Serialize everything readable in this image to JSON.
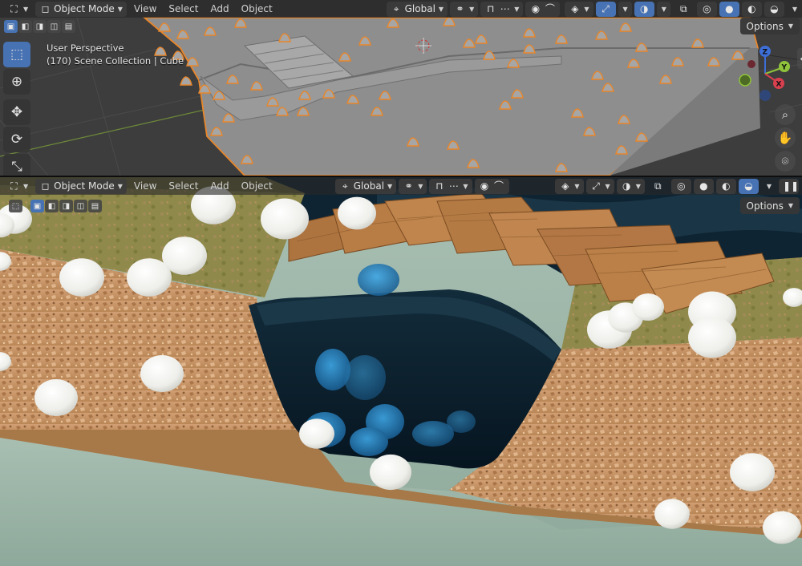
{
  "top_header": {
    "mode_label": "Object Mode",
    "menus": [
      "View",
      "Select",
      "Add",
      "Object"
    ],
    "transform_orientation": "Global",
    "options_label": "Options"
  },
  "bottom_header": {
    "mode_label": "Object Mode",
    "menus": [
      "View",
      "Select",
      "Add",
      "Object"
    ],
    "transform_orientation": "Global",
    "options_label": "Options"
  },
  "top_viewport": {
    "perspective_label": "User Perspective",
    "collection_label": "(170) Scene Collection | Cube"
  },
  "gizmo": {
    "x": "X",
    "y": "Y",
    "z": "Z"
  },
  "colors": {
    "accent": "#4772b3",
    "selection_outline": "#e8862a",
    "water": "#0b2a3a",
    "soil": "#c89467",
    "grass": "#8c8a49",
    "floor": "#9db5a8",
    "wood": "#b77b44"
  }
}
